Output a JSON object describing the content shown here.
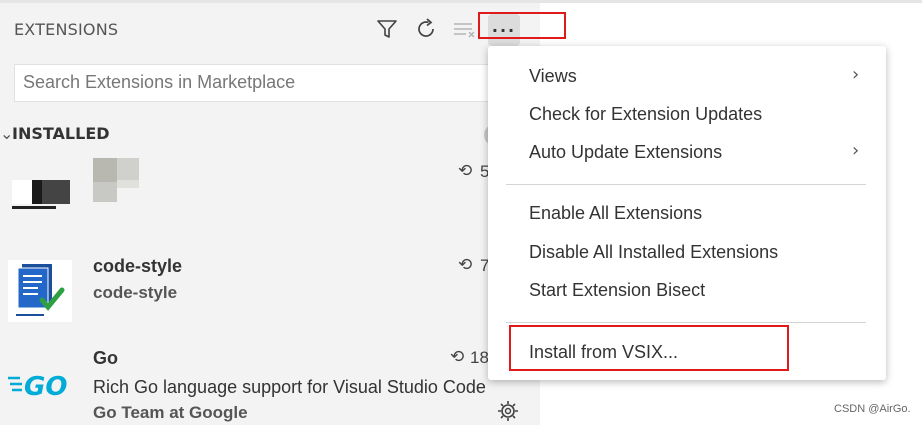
{
  "header": {
    "title": "EXTENSIONS",
    "icons": [
      "filter-icon",
      "refresh-icon",
      "clear-extensions-icon",
      "more-actions-icon"
    ],
    "more_label": "···"
  },
  "search": {
    "placeholder": "Search Extensions in Marketplace"
  },
  "installed": {
    "label": "INSTALLED",
    "chevron": "✓"
  },
  "extensions": [
    {
      "name": "",
      "description": "",
      "publisher": "",
      "stat": "5"
    },
    {
      "name": "code-style",
      "description": "code-style",
      "publisher": "",
      "stat": "7"
    },
    {
      "name": "Go",
      "description": "Rich Go language support for Visual Studio Code",
      "publisher": "Go Team at Google",
      "stat": "18"
    }
  ],
  "menu": {
    "items": [
      {
        "label": "Views",
        "submenu": "›"
      },
      {
        "label": "Check for Extension Updates"
      },
      {
        "label": "Auto Update Extensions",
        "submenu": "›"
      },
      {
        "label": "Enable All Extensions"
      },
      {
        "label": "Disable All Installed Extensions"
      },
      {
        "label": "Start Extension Bisect"
      },
      {
        "label": "Install from VSIX..."
      }
    ]
  },
  "colors": {
    "highlight_box": "#e0191a",
    "go_logo": "#00acd7",
    "check_green": "#2ea043"
  },
  "watermark": "CSDN @AirGo."
}
